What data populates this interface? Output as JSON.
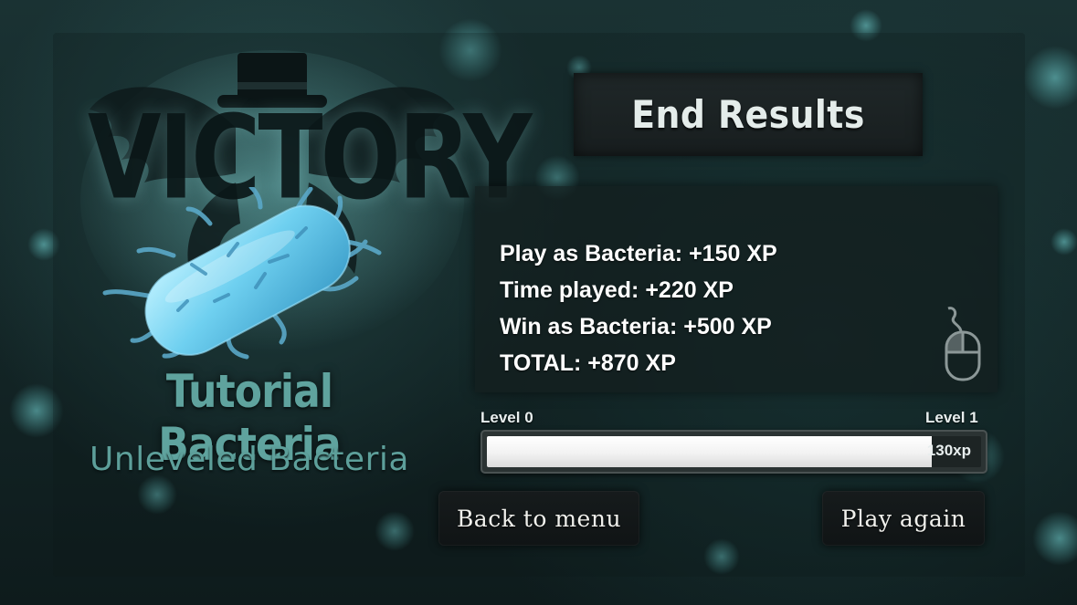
{
  "screen": {
    "banner": "VICTORY"
  },
  "character": {
    "name": "Tutorial Bacteria",
    "rank": "Unleveled Bacteria"
  },
  "results": {
    "title": "End Results",
    "lines": [
      "Play as Bacteria: +150 XP",
      "Time played: +220 XP",
      "Win as Bacteria: +500 XP",
      "TOTAL: +870 XP"
    ]
  },
  "progress": {
    "level_start": "Level 0",
    "level_end": "Level 1",
    "xp_label": "130xp",
    "fill_fraction": 0.9
  },
  "buttons": {
    "back": "Back to menu",
    "again": "Play again"
  },
  "icons": {
    "mouse": "mouse-icon",
    "bacterium": "bacterium-icon",
    "emblem": "winged-hat-emblem-icon"
  },
  "colors": {
    "accent": "#5fa39e",
    "bacterium": "#6fd0f0"
  }
}
